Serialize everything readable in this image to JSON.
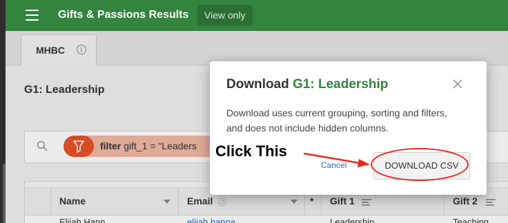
{
  "header": {
    "app_title": "Gifts & Passions Results",
    "view_only_label": "View only"
  },
  "tabs": [
    {
      "label": "MHBC"
    }
  ],
  "section": {
    "title": "G1: Leadership"
  },
  "filter": {
    "keyword": "filter",
    "expression": " gift_1 = \"Leaders"
  },
  "grid": {
    "columns": [
      {
        "label": "Name"
      },
      {
        "label": "Email"
      },
      {
        "label": "*"
      },
      {
        "label": "Gift 1"
      },
      {
        "label": "Gift 2"
      }
    ],
    "first_row": [
      "Elijah Hann…",
      "elijah.hanna…",
      "",
      "Leadership",
      "Teaching"
    ]
  },
  "dialog": {
    "title_prefix": "Download ",
    "title_accent": "G1: Leadership",
    "body": "Download uses current grouping, sorting and filters, and does not include hidden columns.",
    "cancel_label": "Cancel",
    "download_label": "DOWNLOAD CSV"
  },
  "annotation": {
    "text": "Click This",
    "color": "#e8281c"
  },
  "colors": {
    "brand_green": "#33843d",
    "filter_orange": "#e9532a",
    "link_blue": "#1f6fcf"
  }
}
